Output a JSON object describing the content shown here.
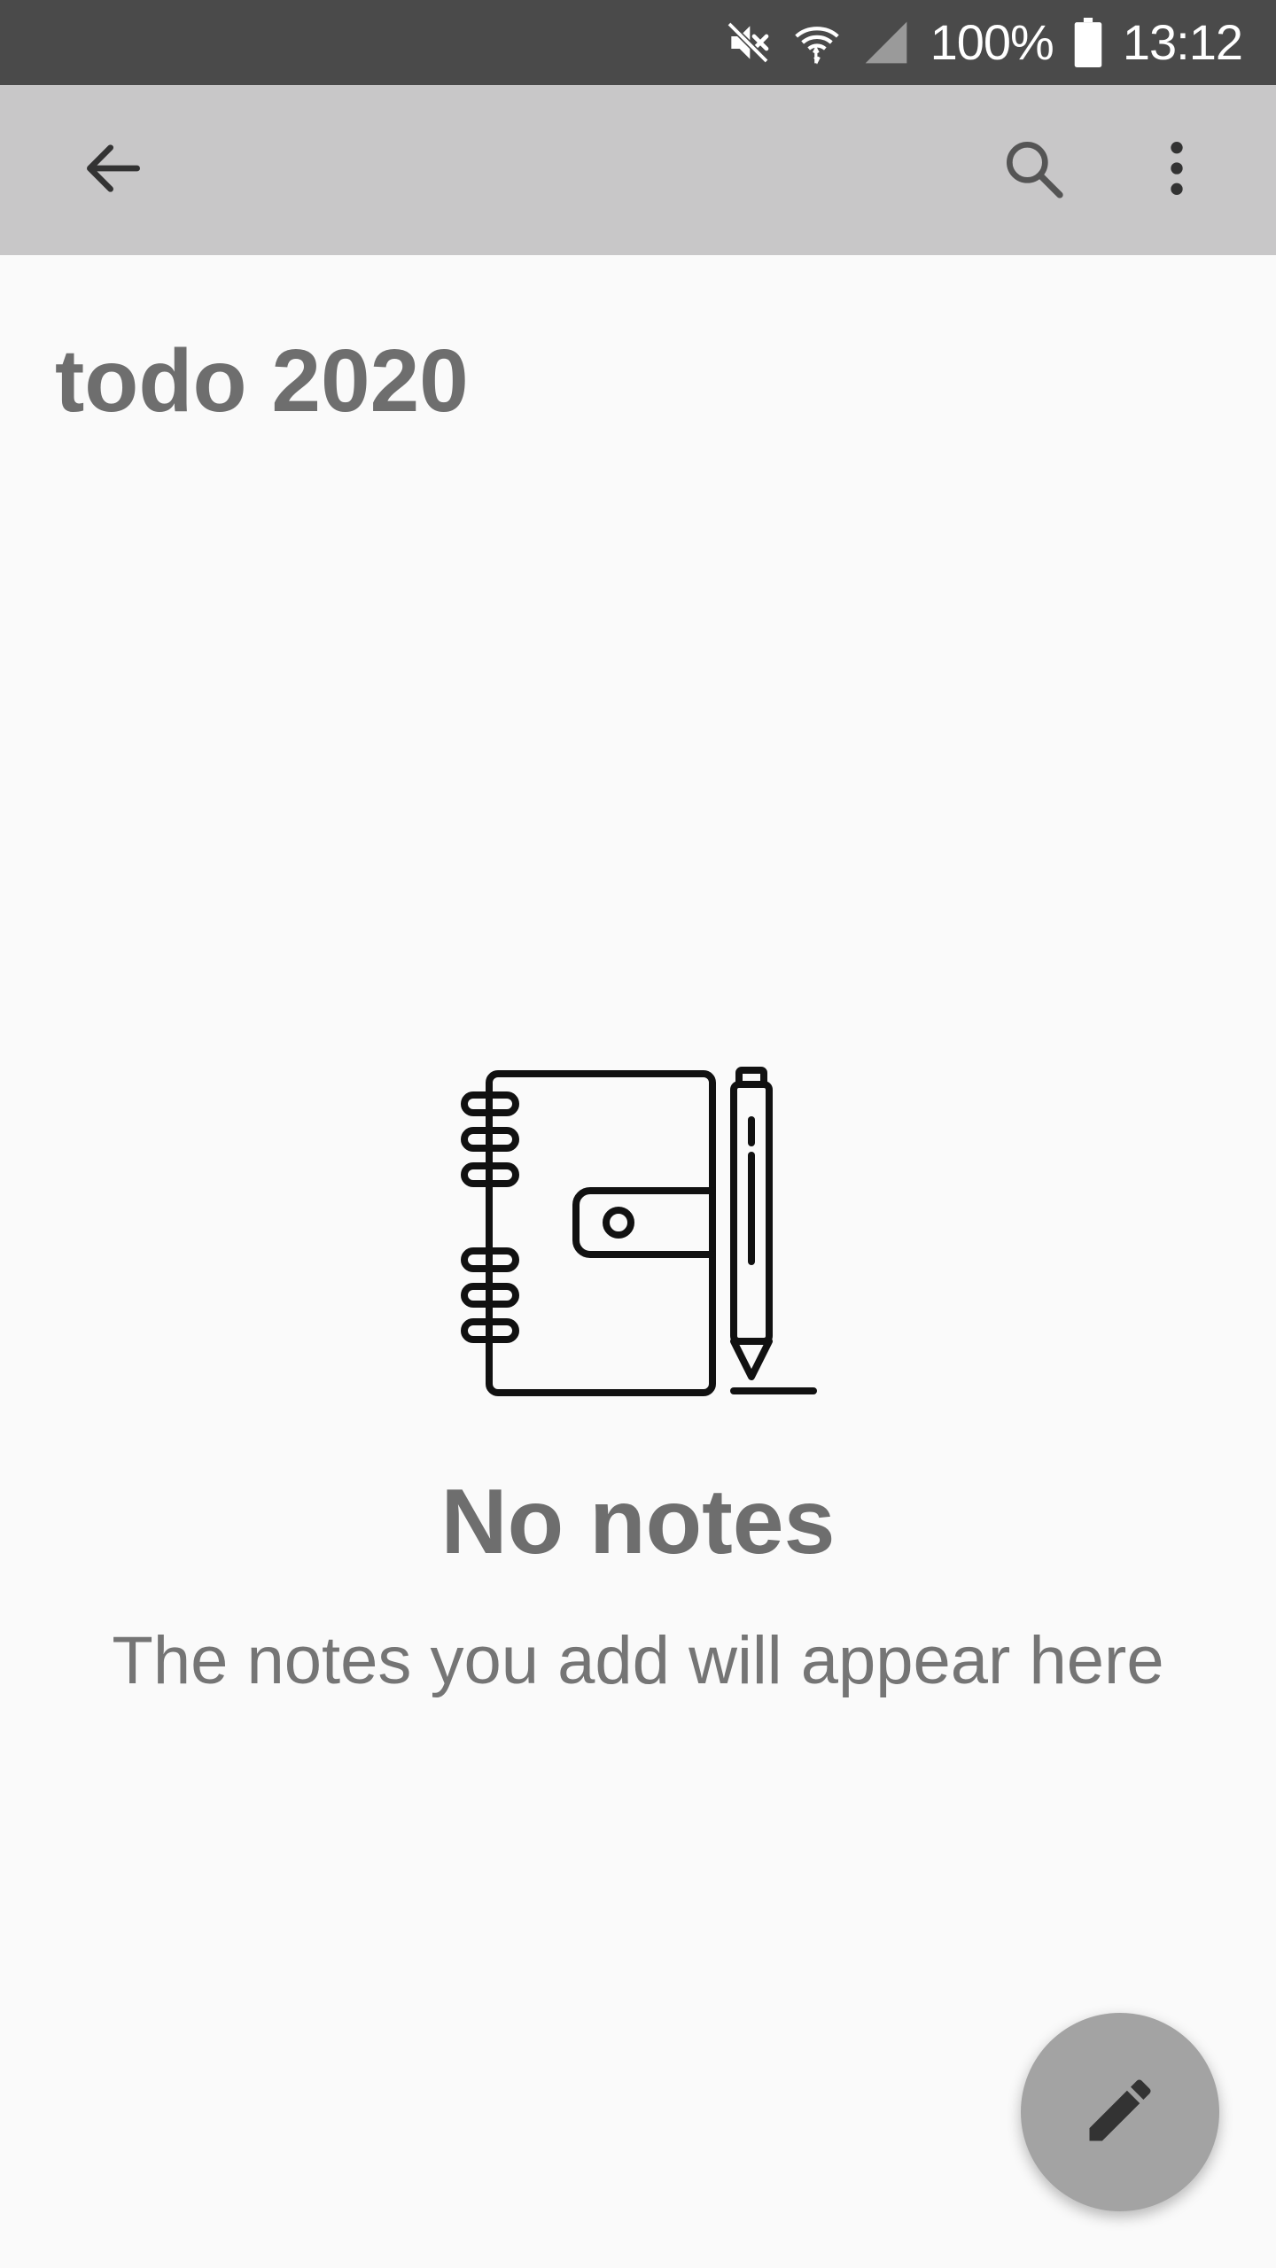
{
  "status_bar": {
    "battery": "100%",
    "time": "13:12",
    "icons": [
      "mute-icon",
      "wifi-icon",
      "signal-icon",
      "battery-icon"
    ]
  },
  "app_bar": {
    "back_icon": "arrow-back-icon",
    "search_icon": "search-icon",
    "more_icon": "more-vertical-icon",
    "background": "#c8c7c8"
  },
  "page": {
    "title": "todo 2020"
  },
  "empty_state": {
    "illustration": "notebook-pen-icon",
    "title": "No notes",
    "subtitle": "The notes you add will appear here"
  },
  "fab": {
    "icon": "pencil-icon",
    "color": "#a3a3a3"
  }
}
